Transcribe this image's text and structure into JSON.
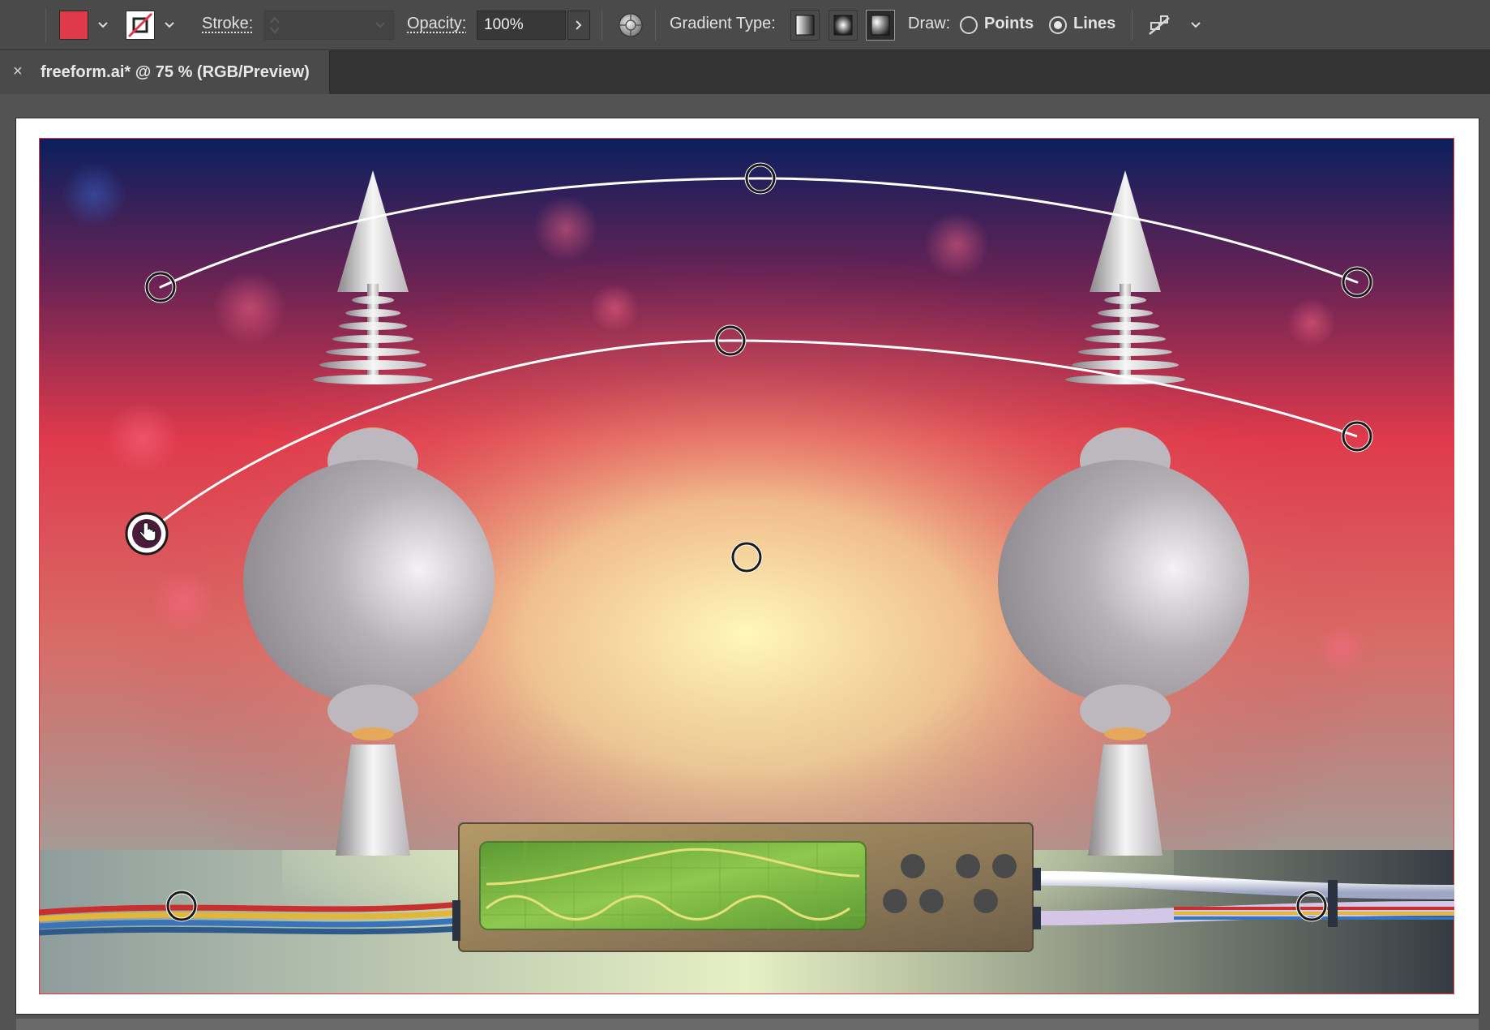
{
  "controlbar": {
    "fill_color": "#e0394a",
    "stroke_label": "Stroke:",
    "stroke_value": "",
    "opacity_label": "Opacity:",
    "opacity_value": "100%",
    "gradient_type_label": "Gradient Type:",
    "gradient_types": [
      "linear",
      "radial",
      "freeform"
    ],
    "active_gradient_type": "freeform",
    "draw_label": "Draw:",
    "draw_options": [
      {
        "label": "Points",
        "selected": false
      },
      {
        "label": "Lines",
        "selected": true
      }
    ],
    "icons": [
      "fill-swatch",
      "stroke-none-swatch",
      "chevron-down-icon",
      "chevron-right-icon",
      "recolor-globe-icon",
      "align-options-icon"
    ]
  },
  "document": {
    "tab_close": "×",
    "tab_title": "freeform.ai* @ 75 % (RGB/Preview)",
    "artboard_border_color": "#e0394a"
  },
  "artwork": {
    "gradient_colors": {
      "top": "#0b1f5e",
      "mid": "#df3a4b",
      "glow": "#fff4a8",
      "bottom_left": "#8a9aa0",
      "bottom_right": "#3b4148"
    },
    "scope_screen_color": "#7fc04a",
    "wire_colors": [
      "#c8302f",
      "#e0b73a",
      "#3a74b8",
      "#ffffff"
    ],
    "gradient_points": 7,
    "gradient_lines": 3
  }
}
